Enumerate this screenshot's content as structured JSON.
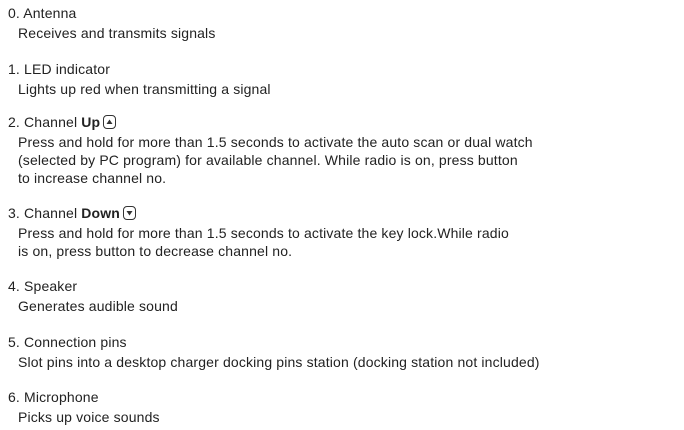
{
  "items": [
    {
      "title": "0. Antenna",
      "desc": [
        "Receives and transmits signals"
      ]
    },
    {
      "title": "1. LED indicator",
      "desc": [
        "Lights up red when transmitting a signal"
      ]
    },
    {
      "title_prefix": "2. Channel ",
      "title_bold": "Up",
      "icon": "up-key-icon",
      "desc": [
        "Press and hold for more than 1.5 seconds to activate the auto scan or dual watch",
        "(selected by PC program) for available channel. While radio is on, press button",
        "to increase channel no."
      ]
    },
    {
      "title_prefix": "3. Channel ",
      "title_bold": "Down",
      "icon": "down-key-icon",
      "desc": [
        "Press and hold for more than 1.5 seconds to activate the key lock.While radio",
        "is on, press button to decrease channel no."
      ]
    },
    {
      "title": "4. Speaker",
      "desc": [
        "Generates audible sound"
      ]
    },
    {
      "title": "5. Connection pins",
      "desc": [
        "Slot pins into a desktop charger docking pins station (docking station not included)"
      ]
    },
    {
      "title": "6. Microphone",
      "desc": [
        "Picks up voice sounds"
      ]
    }
  ]
}
